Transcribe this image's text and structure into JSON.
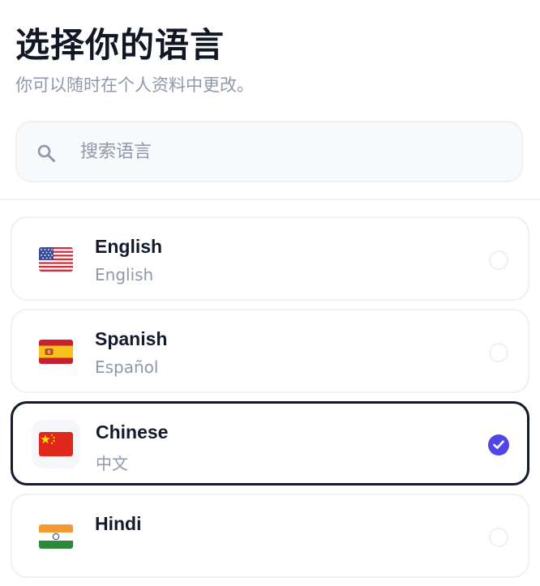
{
  "header": {
    "title": "选择你的语言",
    "subtitle": "你可以随时在个人资料中更改。"
  },
  "search": {
    "icon": "search-icon",
    "placeholder": "搜索语言",
    "value": ""
  },
  "languages": [
    {
      "name": "English",
      "native": "English",
      "flag": "us-flag-icon",
      "selected": false
    },
    {
      "name": "Spanish",
      "native": "Español",
      "flag": "spain-flag-icon",
      "selected": false
    },
    {
      "name": "Chinese",
      "native": "中文",
      "flag": "china-flag-icon",
      "selected": true
    },
    {
      "name": "Hindi",
      "native": "",
      "flag": "india-flag-icon",
      "selected": false
    }
  ],
  "colors": {
    "accent": "#4f46e5",
    "text_primary": "#141a2e",
    "text_secondary": "#8f98ab",
    "border": "#eef0f4",
    "selected_border": "#141a2e"
  }
}
